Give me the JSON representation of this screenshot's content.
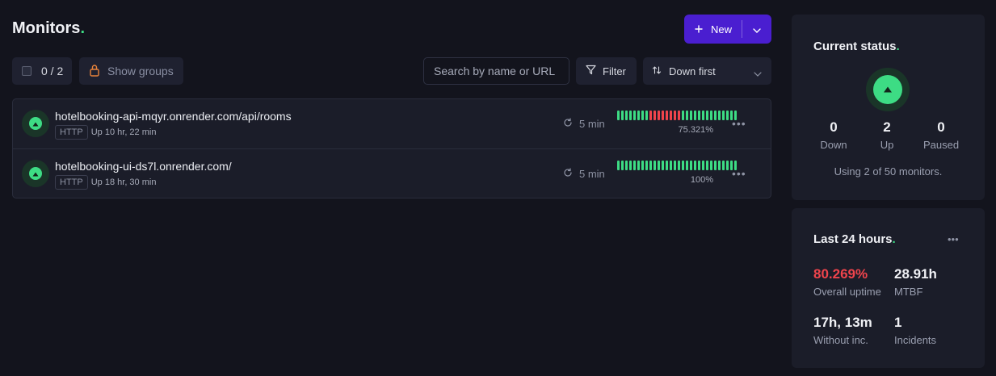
{
  "header": {
    "title": "Monitors",
    "title_dot": ".",
    "new_label": "New"
  },
  "toolbar": {
    "selection_count": "0 / 2",
    "show_groups_label": "Show groups",
    "search_placeholder": "Search by name or URL",
    "filter_label": "Filter",
    "sort_label": "Down first"
  },
  "monitors": [
    {
      "url": "hotelbooking-api-mqyr.onrender.com/api/rooms",
      "protocol": "HTTP",
      "uptime_text": "Up 10 hr, 22 min",
      "interval": "5 min",
      "uptime_pct": "75.321%",
      "history": [
        "up",
        "up",
        "up",
        "up",
        "up",
        "up",
        "up",
        "up",
        "down",
        "down",
        "down",
        "down",
        "down",
        "down",
        "down",
        "down",
        "up",
        "up",
        "up",
        "up",
        "up",
        "up",
        "up",
        "up",
        "up",
        "up",
        "up",
        "up",
        "up",
        "up"
      ]
    },
    {
      "url": "hotelbooking-ui-ds7l.onrender.com/",
      "protocol": "HTTP",
      "uptime_text": "Up 18 hr, 30 min",
      "interval": "5 min",
      "uptime_pct": "100%",
      "history": [
        "up",
        "up",
        "up",
        "up",
        "up",
        "up",
        "up",
        "up",
        "up",
        "up",
        "up",
        "up",
        "up",
        "up",
        "up",
        "up",
        "up",
        "up",
        "up",
        "up",
        "up",
        "up",
        "up",
        "up",
        "up",
        "up",
        "up",
        "up",
        "up",
        "up"
      ]
    }
  ],
  "current_status": {
    "title": "Current status",
    "down_count": "0",
    "down_label": "Down",
    "up_count": "2",
    "up_label": "Up",
    "paused_count": "0",
    "paused_label": "Paused",
    "usage_text": "Using 2 of 50 monitors."
  },
  "last_24h": {
    "title": "Last 24 hours",
    "overall_uptime_value": "80.269%",
    "overall_uptime_label": "Overall uptime",
    "mtbf_value": "28.91h",
    "mtbf_label": "MTBF",
    "without_inc_value": "17h, 13m",
    "without_inc_label": "Without inc.",
    "incidents_value": "1",
    "incidents_label": "Incidents"
  },
  "colors": {
    "up": "#3ddc84",
    "down": "#f0444c",
    "accent": "#4a1ed0",
    "background": "#13141d"
  }
}
